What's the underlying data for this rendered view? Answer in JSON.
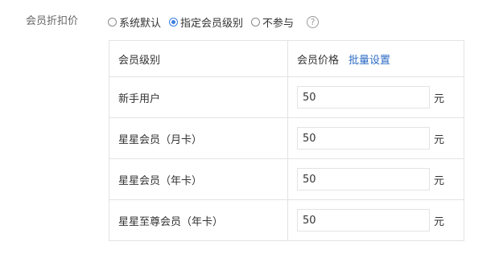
{
  "field_label": "会员折扣价",
  "options": [
    {
      "label": "系统默认",
      "checked": false
    },
    {
      "label": "指定会员级别",
      "checked": true
    },
    {
      "label": "不参与",
      "checked": false
    }
  ],
  "help_icon": "?",
  "table": {
    "header_level": "会员级别",
    "header_price": "会员价格",
    "batch_link": "批量设置",
    "unit": "元",
    "rows": [
      {
        "level": "新手用户",
        "price": "50"
      },
      {
        "level": "星星会员（月卡）",
        "price": "50"
      },
      {
        "level": "星星会员（年卡）",
        "price": "50"
      },
      {
        "level": "星星至尊会员（年卡）",
        "price": "50"
      }
    ]
  },
  "colors": {
    "accent": "#3b7fe0",
    "link": "#2c6bc5",
    "border": "#e3e3e3"
  }
}
